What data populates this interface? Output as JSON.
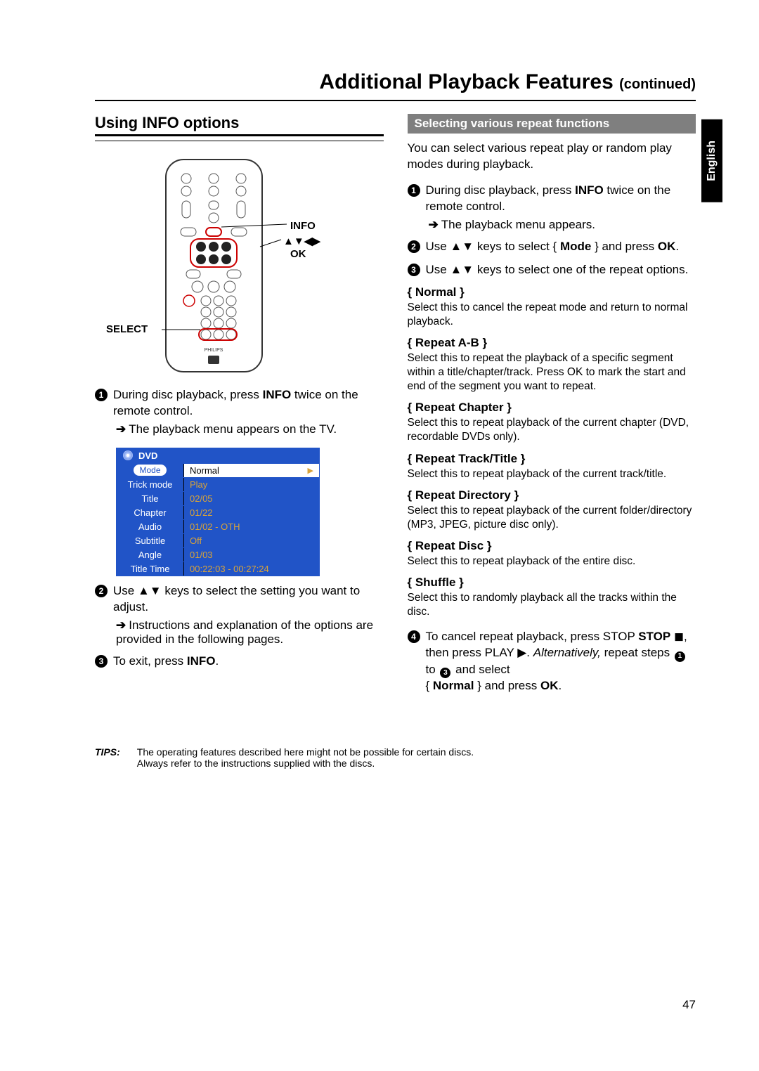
{
  "language_tab": "English",
  "chapter": {
    "title": "Additional Playback Features",
    "suffix": "(continued)"
  },
  "left": {
    "section_title": "Using INFO options",
    "remote_labels": {
      "info": "INFO",
      "arrows": "▲▼◀▶",
      "ok": "OK",
      "select": "SELECT"
    },
    "step1": "During disc playback, press INFO twice on the remote control.",
    "step1_sub": "The playback menu appears on the TV.",
    "osd": {
      "header": "DVD",
      "rows": [
        {
          "label": "Mode",
          "value": "Normal",
          "selected": true
        },
        {
          "label": "Trick mode",
          "value": "Play"
        },
        {
          "label": "Title",
          "value": "02/05"
        },
        {
          "label": "Chapter",
          "value": "01/22"
        },
        {
          "label": "Audio",
          "value": "01/02 - OTH"
        },
        {
          "label": "Subtitle",
          "value": "Off"
        },
        {
          "label": "Angle",
          "value": "01/03"
        },
        {
          "label": "Title Time",
          "value": "00:22:03 - 00:27:24"
        }
      ]
    },
    "step2": "Use ▲▼ keys to select the setting you want to adjust.",
    "step2_sub": "Instructions and explanation of the options are provided in the following pages.",
    "step3": "To exit, press INFO."
  },
  "right": {
    "bar": "Selecting various repeat functions",
    "intro": "You can select various repeat play or random play modes during playback.",
    "s1": "During disc playback, press INFO twice on the remote control.",
    "s1_sub": "The playback menu appears.",
    "s2": "Use ▲▼ keys to select { Mode } and press OK.",
    "s3": "Use ▲▼ keys to select one of the repeat options.",
    "options": [
      {
        "name": "{ Normal }",
        "desc": "Select this to cancel the repeat mode and return to normal playback."
      },
      {
        "name": "{ Repeat A-B }",
        "desc": "Select this to repeat the playback of a specific segment within a title/chapter/track. Press OK to mark the start and end of the segment you want to repeat."
      },
      {
        "name": "{ Repeat Chapter }",
        "desc": "Select this to repeat playback of the current chapter (DVD, recordable DVDs only)."
      },
      {
        "name": "{ Repeat Track/Title }",
        "desc": "Select this to repeat playback of the current track/title."
      },
      {
        "name": "{ Repeat Directory }",
        "desc": "Select this to repeat playback of the current folder/directory (MP3, JPEG, picture disc only)."
      },
      {
        "name": "{ Repeat Disc }",
        "desc": "Select this to repeat playback of the entire disc."
      },
      {
        "name": "{ Shuffle }",
        "desc": "Select this to randomly playback all the tracks within the disc."
      }
    ],
    "s4_a": "To cancel repeat playback, press STOP",
    "s4_b": "◼, then press PLAY ▶.",
    "s4_c": "Alternatively,",
    "s4_d": "repeat steps",
    "s4_e": "to",
    "s4_f": "and select",
    "s4_g": "{ Normal } and press OK."
  },
  "tips": {
    "label": "TIPS:",
    "text": "The operating features described here might not be possible for certain discs.\nAlways refer to the instructions supplied with the discs."
  },
  "page_number": "47"
}
